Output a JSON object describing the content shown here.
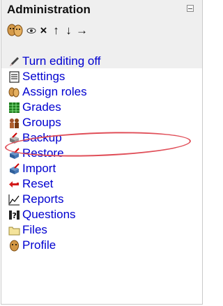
{
  "block": {
    "title": "Administration",
    "controls": [
      "×",
      "↑",
      "↓",
      "→"
    ]
  },
  "items": [
    {
      "label": "Turn editing off",
      "icon": "pencil-icon"
    },
    {
      "label": "Settings",
      "icon": "settings-document-icon"
    },
    {
      "label": "Assign roles",
      "icon": "roles-icon"
    },
    {
      "label": "Grades",
      "icon": "grades-icon"
    },
    {
      "label": "Groups",
      "icon": "groups-icon"
    },
    {
      "label": "Backup",
      "icon": "backup-icon"
    },
    {
      "label": "Restore",
      "icon": "restore-icon"
    },
    {
      "label": "Import",
      "icon": "import-icon"
    },
    {
      "label": "Reset",
      "icon": "reset-icon"
    },
    {
      "label": "Reports",
      "icon": "reports-icon"
    },
    {
      "label": "Questions",
      "icon": "questions-icon"
    },
    {
      "label": "Files",
      "icon": "folder-icon"
    },
    {
      "label": "Profile",
      "icon": "profile-icon"
    }
  ],
  "colors": {
    "link": "#0000d0",
    "highlight_circle": "#e04e58",
    "header_bg": "#efefef"
  }
}
